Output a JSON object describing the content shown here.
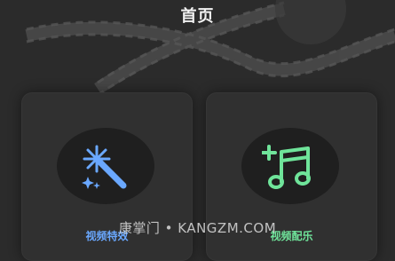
{
  "header": {
    "title": "首页"
  },
  "cards": [
    {
      "label": "视频特效",
      "icon": "magic-wand-icon",
      "color": "#6aa8ff"
    },
    {
      "label": "视频配乐",
      "icon": "music-add-icon",
      "color": "#6fe49a"
    }
  ],
  "watermark": "康掌门 • KANGZM.COM",
  "colors": {
    "background": "#2b2b2b",
    "card": "#303030",
    "icon_bg": "#1f1f1f"
  }
}
